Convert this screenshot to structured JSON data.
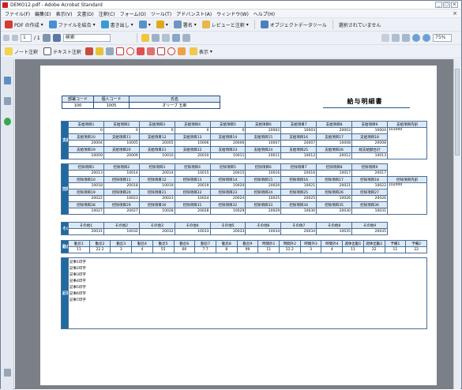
{
  "window": {
    "title": "DEMO12.pdf - Adobe Acrobat Standard",
    "buttons": [
      "_",
      "□",
      "×"
    ]
  },
  "menu": [
    "ファイル(F)",
    "編集(E)",
    "表示(V)",
    "文書(D)",
    "注釈(C)",
    "フォーム(O)",
    "ツール(T)",
    "アドバンスト(A)",
    "ウィンドウ(W)",
    "ヘルプ(H)"
  ],
  "toolbar1": {
    "pdf_create": "PDF の作成",
    "combine": "ファイルを結合",
    "export": "書き出し",
    "sign": "署名",
    "review": "レビューと注釈",
    "object_tool": "オブジェクトデータツール",
    "no_selection": "選択されていません"
  },
  "toolbar2": {
    "page": "1",
    "pages": "/ 1",
    "search_placeholder": "検索",
    "zoom": "75%"
  },
  "toolbar3": {
    "note": "ノート注釈",
    "text_note": "テキスト注釈",
    "show": "表示"
  },
  "doc": {
    "title": "給与明細書",
    "header_labels": [
      "部署コード",
      "個人コード",
      "氏名"
    ],
    "header_values": [
      "100",
      "1005",
      "オリーブ 五郎"
    ],
    "side_labels": {
      "pay": "支給項目",
      "deduct": "控除項目",
      "other": "その他",
      "work": "勤怠項目",
      "note": "記事項目"
    },
    "pay": {
      "r1_labels": [
        "支給項目1",
        "支給項目2",
        "支給項目3",
        "支給項目4",
        "支給項目5",
        "支給項目6",
        "支給項目7",
        "支給項目8",
        "支給項目9"
      ],
      "r1_values": [
        "0",
        "0",
        "0",
        "0",
        "0",
        "20002",
        "10003",
        "20003",
        "10004"
      ],
      "r2_labels": [
        "支給項目10",
        "支給項目11",
        "支給項目12",
        "支給項目13",
        "支給項目14",
        "支給項目15",
        "支給項目16",
        "支給項目17",
        "支給項目18"
      ],
      "r2_values": [
        "20004",
        "10005",
        "20005",
        "10006",
        "20006",
        "10007",
        "20007",
        "10008",
        "20008"
      ],
      "r3_labels": [
        "支給項目19",
        "支給項目20",
        "支給項目21",
        "支給項目22",
        "支給項目23",
        "支給項目24",
        "支給項目25",
        "支給項目26",
        "総支給額合計"
      ],
      "r3_values": [
        "10009",
        "20009",
        "10010",
        "20010",
        "10011",
        "20011",
        "10012",
        "20012",
        "10013"
      ],
      "detail_label": "支給項目内訳",
      "detail_value": "101000"
    },
    "deduct": {
      "r1_labels": [
        "控除項目1",
        "控除項目2",
        "控除項目3",
        "控除項目4",
        "控除項目5",
        "控除項目6",
        "控除項目7",
        "控除項目8",
        "控除項目9"
      ],
      "r1_values": [
        "20013",
        "10014",
        "20014",
        "10015",
        "20015",
        "10016",
        "20016",
        "10017",
        "20017"
      ],
      "r2_labels": [
        "控除項目10",
        "控除項目11",
        "控除項目12",
        "控除項目13",
        "控除項目14",
        "控除項目15",
        "控除項目16",
        "控除項目17",
        "控除項目18"
      ],
      "r2_values": [
        "10018",
        "20018",
        "10019",
        "20019",
        "10020",
        "20020",
        "10021",
        "20021",
        "10022"
      ],
      "r3_labels": [
        "控除項目19",
        "控除項目20",
        "控除項目21",
        "控除項目22",
        "控除項目23",
        "控除項目24",
        "控除項目25",
        "控除項目26",
        "控除項目27"
      ],
      "r3_values": [
        "20022",
        "10023",
        "20023",
        "10024",
        "20024",
        "10025",
        "20025",
        "10026",
        "20026"
      ],
      "r4_labels": [
        "控除項目28",
        "控除項目29",
        "控除項目30",
        "控除項目31",
        "控除項目32",
        "控除項目33",
        "控除項目34",
        "控除項目35",
        "控除項目36"
      ],
      "r4_values": [
        "10027",
        "20027",
        "10028",
        "20028",
        "10029",
        "20029",
        "10030",
        "20030",
        "10031"
      ],
      "detail_label": "控除項目内訳",
      "detail_value": "102000"
    },
    "other": {
      "labels": [
        "その他1",
        "その他2",
        "その他3",
        "その他4",
        "その他5",
        "その他6",
        "その他7",
        "その他8",
        "その他9"
      ],
      "values": [
        "20031",
        "10032",
        "20032",
        "10033",
        "20033",
        "10034",
        "20034",
        "10035",
        "20035"
      ]
    },
    "work": {
      "labels": [
        "勤怠1",
        "勤怠2",
        "勤怠3",
        "勤怠4",
        "勤怠5",
        "勤怠6",
        "勤怠7",
        "勤怠8",
        "勤怠9",
        "時間外1",
        "時間外2",
        "時間外3",
        "時間外4",
        "週休出勤1",
        "週休出勤2",
        "予備1",
        "予備2"
      ],
      "values": [
        "11",
        "22.2",
        "3",
        "4",
        "55",
        "66",
        "7.7",
        "8",
        "99",
        "11",
        "22.2",
        "3",
        "4",
        "11",
        "22",
        "11",
        "22"
      ]
    },
    "notes": [
      "記事1印字",
      "記事2印字",
      "記事3印字",
      "記事4印字",
      "記事5印字",
      "記事6印字",
      "記事7印字"
    ]
  }
}
